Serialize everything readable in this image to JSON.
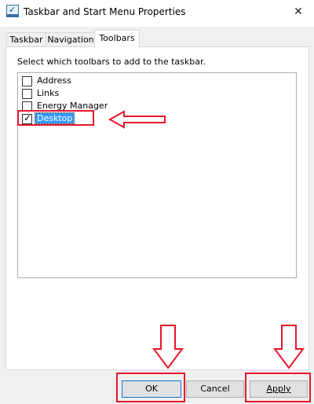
{
  "window": {
    "title": "Taskbar and Start Menu Properties",
    "close_glyph": "✕",
    "icon": "taskbar-properties-icon"
  },
  "tabs": [
    {
      "label": "Taskbar",
      "active": false
    },
    {
      "label": "Navigation",
      "active": false
    },
    {
      "label": "Toolbars",
      "active": true
    }
  ],
  "toolbars": {
    "instruction": "Select which toolbars to add to the taskbar.",
    "items": [
      {
        "label": "Address",
        "checked": false,
        "selected": false
      },
      {
        "label": "Links",
        "checked": false,
        "selected": false
      },
      {
        "label": "Energy Manager",
        "checked": false,
        "selected": false
      },
      {
        "label": "Desktop",
        "checked": true,
        "selected": true
      }
    ]
  },
  "buttons": {
    "ok": "OK",
    "cancel": "Cancel",
    "apply": "Apply"
  },
  "annotation_color": "#e8162a"
}
